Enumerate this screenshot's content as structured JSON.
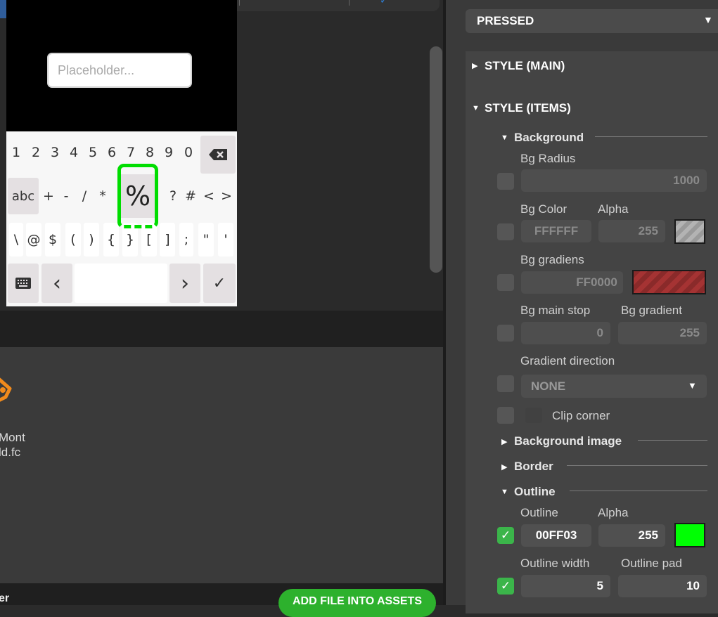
{
  "preview": {
    "textarea_placeholder": "Placeholder...",
    "keyboard": {
      "row1": [
        "1",
        "2",
        "3",
        "4",
        "5",
        "6",
        "7",
        "8",
        "9",
        "0"
      ],
      "backspace_icon": "backspace-icon",
      "row2_mode": "abc",
      "row2": [
        "+",
        "-",
        "/",
        "*",
        "!",
        "?",
        "#",
        "<",
        ">"
      ],
      "pressed_key": "%",
      "row3": [
        "\\",
        "@",
        "$",
        "(",
        ")",
        "{",
        "}",
        "[",
        "]",
        ";",
        "\"",
        "'"
      ],
      "keyboard_icon": "keyboard-icon",
      "left_arrow": "‹",
      "right_arrow": "›",
      "ok_icon": "✓"
    },
    "outline_color": "#00FF03"
  },
  "assets": {
    "file_name_line1": "Mont",
    "file_name_line2": "ld.fc",
    "bottom_text": "er",
    "add_button": "ADD FILE INTO ASSETS"
  },
  "inspector": {
    "state": "PRESSED",
    "style_main": "STYLE (MAIN)",
    "style_items": "STYLE (ITEMS)",
    "background": {
      "title": "Background",
      "bg_radius_label": "Bg Radius",
      "bg_radius_value": "1000",
      "bg_color_label": "Bg Color",
      "bg_color_value": "FFFFFF",
      "alpha_label": "Alpha",
      "alpha_value": "255",
      "bg_grad_label": "Bg gradiens",
      "bg_grad_value": "FF0000",
      "main_stop_label": "Bg main stop",
      "main_stop_value": "0",
      "grad_stop_label": "Bg gradient",
      "grad_stop_value": "255",
      "grad_dir_label": "Gradient direction",
      "grad_dir_value": "NONE",
      "clip_corner_label": "Clip corner"
    },
    "background_image": "Background image",
    "border": "Border",
    "outline": {
      "title": "Outline",
      "outline_label": "Outline",
      "outline_value": "00FF03",
      "alpha_label": "Alpha",
      "alpha_value": "255",
      "width_label": "Outline width",
      "width_value": "5",
      "pad_label": "Outline pad",
      "pad_value": "10"
    }
  }
}
